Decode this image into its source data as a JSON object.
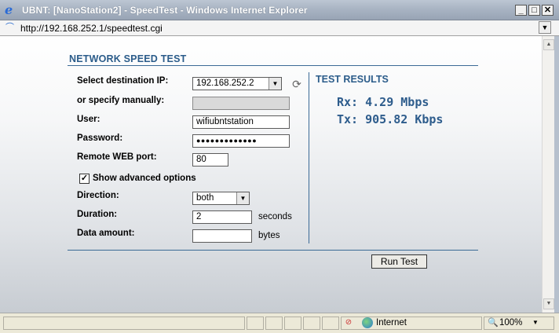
{
  "window": {
    "title": "UBNT: [NanoStation2] - SpeedTest - Windows Internet Explorer",
    "icon": "ie-logo-icon"
  },
  "address": {
    "url": "http://192.168.252.1/speedtest.cgi"
  },
  "form": {
    "heading": "NETWORK SPEED TEST",
    "destination_label": "Select destination IP:",
    "destination_value": "192.168.252.2",
    "manual_label": "or specify manually:",
    "manual_value": "",
    "user_label": "User:",
    "user_value": "wifiubntstation",
    "password_label": "Password:",
    "password_value": "●●●●●●●●●●●●●",
    "port_label": "Remote WEB port:",
    "port_value": "80",
    "advanced_label": "Show advanced options",
    "advanced_checked": true,
    "direction_label": "Direction:",
    "direction_value": "both",
    "duration_label": "Duration:",
    "duration_value": "2",
    "duration_unit": "seconds",
    "amount_label": "Data amount:",
    "amount_value": "",
    "amount_unit": "bytes",
    "run_button": "Run Test"
  },
  "results": {
    "title": "TEST RESULTS",
    "rx": "Rx: 4.29 Mbps",
    "tx": "Tx: 905.82 Kbps"
  },
  "status": {
    "zone": "Internet",
    "zoom": "100%"
  },
  "colors": {
    "heading": "#2b5c8a",
    "result_text": "#2d5c8c"
  }
}
